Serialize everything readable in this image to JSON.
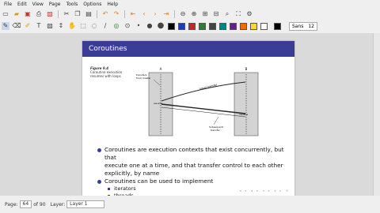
{
  "menu": [
    "File",
    "Edit",
    "View",
    "Page",
    "Tools",
    "Options",
    "Help"
  ],
  "toolbar1": {
    "icons": [
      "new-icon",
      "open-icon",
      "save-icon",
      "print-icon",
      "image-icon",
      "cut-icon",
      "copy-icon",
      "paste-icon",
      "undo-icon",
      "redo-icon",
      "prev-page-icon",
      "next-page-icon",
      "first-page-icon",
      "last-page-icon",
      "zoom-out-icon",
      "zoom-in-icon",
      "search-icon",
      "fullscreen-icon",
      "settings-icon"
    ]
  },
  "toolbar2": {
    "swatches": [
      "#000000",
      "#1a3fb5",
      "#c62828",
      "#2e7d32",
      "#444444",
      "#00838f",
      "#6a1b9a",
      "#ef6c00",
      "#fdd835",
      "#ffffff",
      "#000000"
    ],
    "font_name": "Sans",
    "font_size": "12"
  },
  "slide": {
    "title": "Coroutines",
    "figure_label": "Figure 9.4",
    "figure_caption": [
      "Coroutine execution",
      "resumes with loops"
    ],
    "diagram": {
      "label_a": "A",
      "label_b": "B",
      "note_top": [
        "transfers",
        "from master"
      ],
      "note_bottom": [
        "Subsequent",
        "transfer"
      ],
      "arrow_label": "Initial transfer",
      "resume_label": "resume"
    },
    "bullets": [
      "Coroutines are execution contexts that exist concurrently, but that",
      "execute one at a time, and that transfer control to each other",
      "explicitly, by name",
      "Coroutines can be used to implement"
    ],
    "sub_bullets": [
      "iterators",
      "threads"
    ]
  },
  "status": {
    "page_label": "Page:",
    "page_value": "64",
    "of_label": "of 90",
    "layer_label": "Layer:",
    "layer_value": "Layer 1"
  }
}
